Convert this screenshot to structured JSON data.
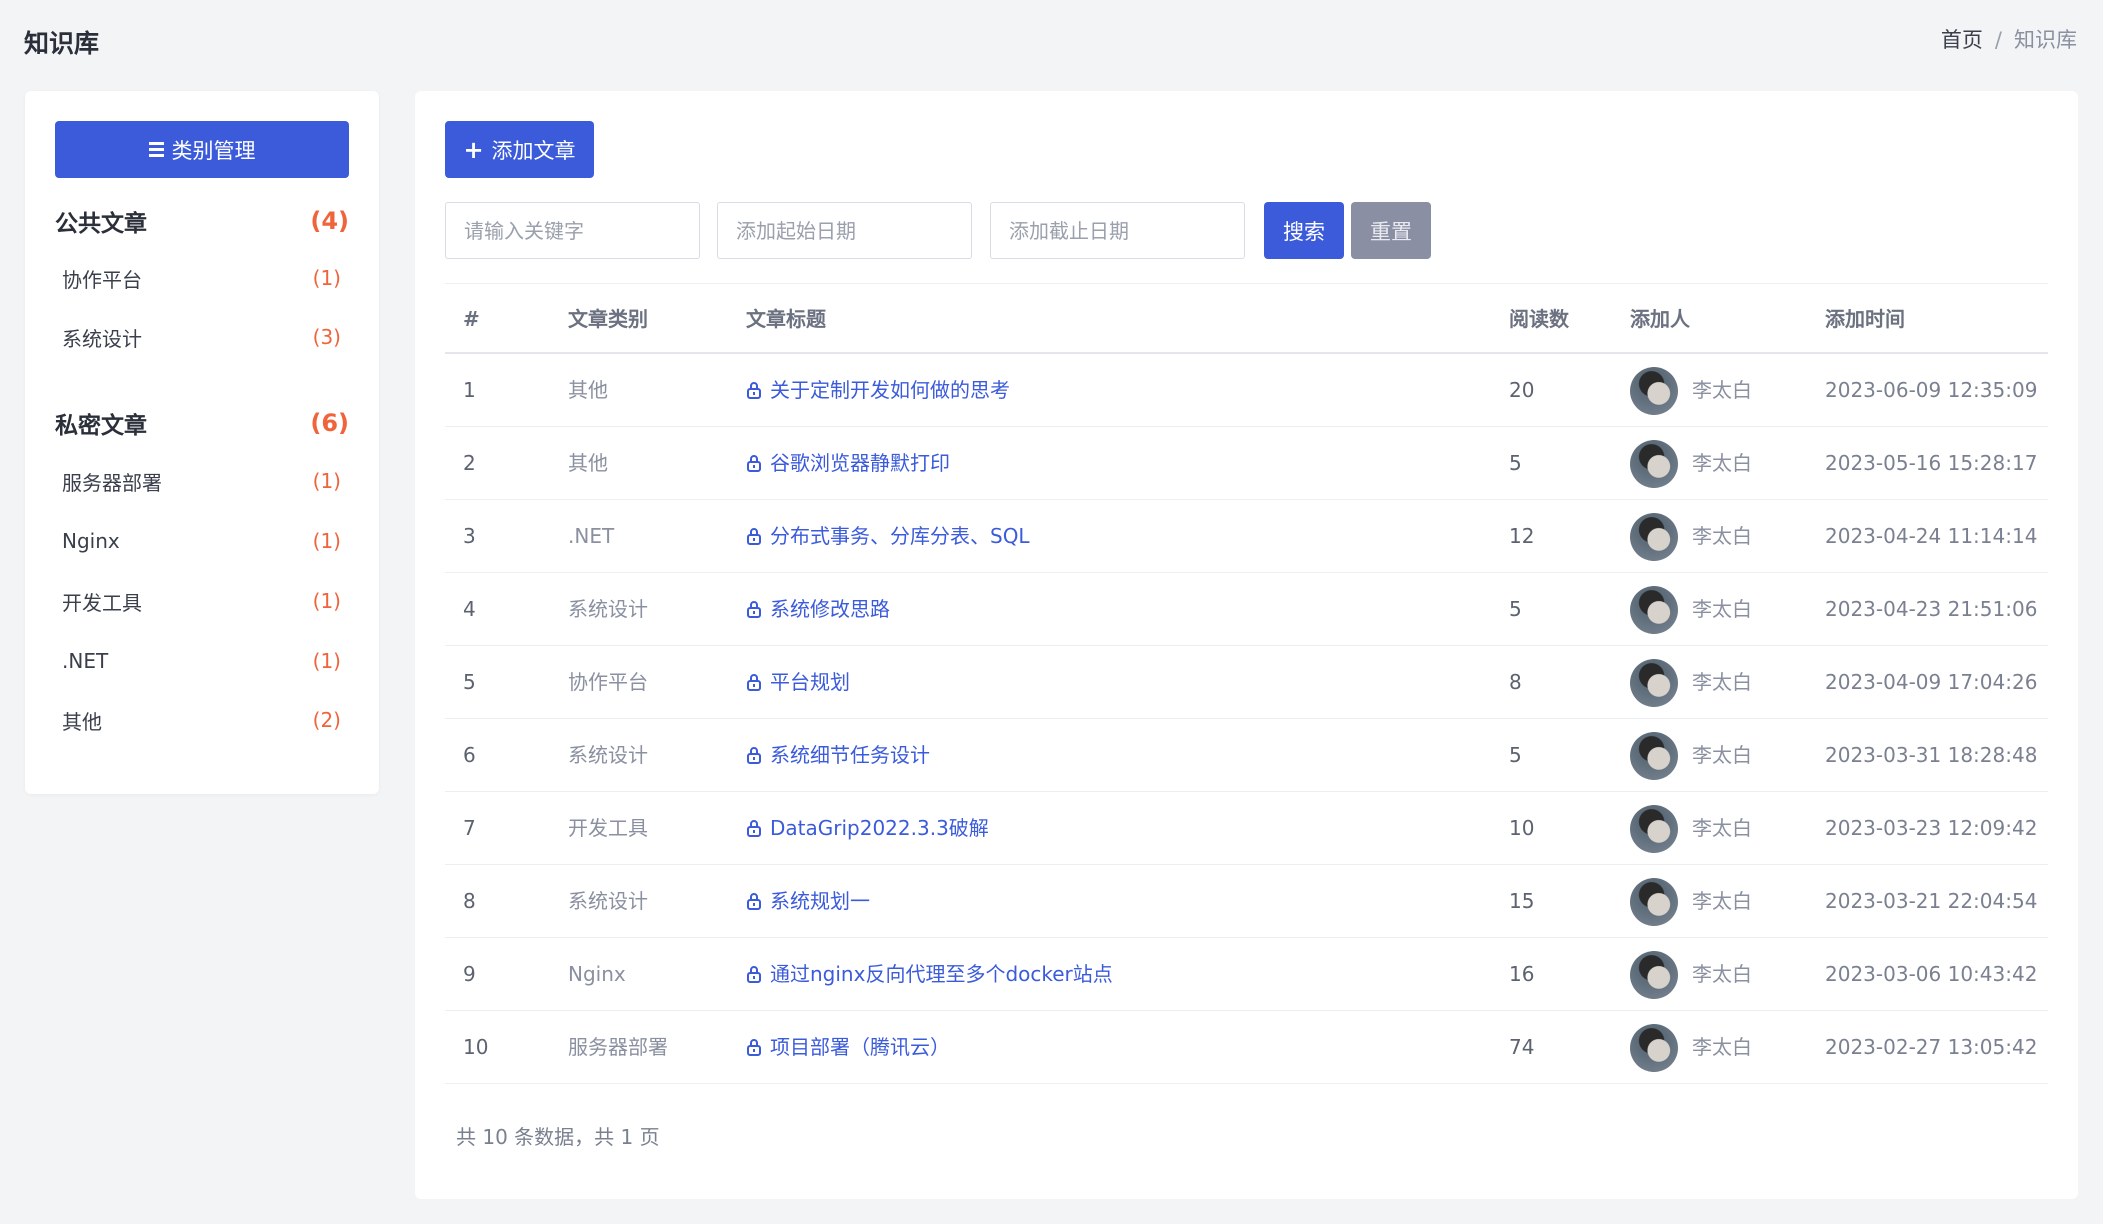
{
  "header": {
    "title": "知识库",
    "breadcrumb": [
      "首页",
      "知识库"
    ]
  },
  "sidebar": {
    "manage_button": "类别管理",
    "public_group": {
      "label": "公共文章",
      "count": "(4)"
    },
    "public_items": [
      {
        "label": "协作平台",
        "count": "(1)"
      },
      {
        "label": "系统设计",
        "count": "(3)"
      }
    ],
    "private_group": {
      "label": "私密文章",
      "count": "(6)"
    },
    "private_items": [
      {
        "label": "服务器部署",
        "count": "(1)"
      },
      {
        "label": "Nginx",
        "count": "(1)"
      },
      {
        "label": "开发工具",
        "count": "(1)"
      },
      {
        "label": ".NET",
        "count": "(1)"
      },
      {
        "label": "其他",
        "count": "(2)"
      }
    ]
  },
  "main": {
    "add_button": "添加文章",
    "search": {
      "keyword_placeholder": "请输入关键字",
      "start_placeholder": "添加起始日期",
      "end_placeholder": "添加截止日期",
      "search_label": "搜索",
      "reset_label": "重置"
    },
    "columns": [
      "#",
      "文章类别",
      "文章标题",
      "阅读数",
      "添加人",
      "添加时间"
    ],
    "rows": [
      {
        "no": "1",
        "category": "其他",
        "title": "关于定制开发如何做的思考",
        "reads": "20",
        "author": "李太白",
        "time": "2023-06-09 12:35:09"
      },
      {
        "no": "2",
        "category": "其他",
        "title": "谷歌浏览器静默打印",
        "reads": "5",
        "author": "李太白",
        "time": "2023-05-16 15:28:17"
      },
      {
        "no": "3",
        "category": ".NET",
        "title": "分布式事务、分库分表、SQL",
        "reads": "12",
        "author": "李太白",
        "time": "2023-04-24 11:14:14"
      },
      {
        "no": "4",
        "category": "系统设计",
        "title": "系统修改思路",
        "reads": "5",
        "author": "李太白",
        "time": "2023-04-23 21:51:06"
      },
      {
        "no": "5",
        "category": "协作平台",
        "title": "平台规划",
        "reads": "8",
        "author": "李太白",
        "time": "2023-04-09 17:04:26"
      },
      {
        "no": "6",
        "category": "系统设计",
        "title": "系统细节任务设计",
        "reads": "5",
        "author": "李太白",
        "time": "2023-03-31 18:28:48"
      },
      {
        "no": "7",
        "category": "开发工具",
        "title": "DataGrip2022.3.3破解",
        "reads": "10",
        "author": "李太白",
        "time": "2023-03-23 12:09:42"
      },
      {
        "no": "8",
        "category": "系统设计",
        "title": "系统规划一",
        "reads": "15",
        "author": "李太白",
        "time": "2023-03-21 22:04:54"
      },
      {
        "no": "9",
        "category": "Nginx",
        "title": "通过nginx反向代理至多个docker站点",
        "reads": "16",
        "author": "李太白",
        "time": "2023-03-06 10:43:42"
      },
      {
        "no": "10",
        "category": "服务器部署",
        "title": "项目部署（腾讯云）",
        "reads": "74",
        "author": "李太白",
        "time": "2023-02-27 13:05:42"
      }
    ],
    "footer": "共 10 条数据，共 1 页"
  },
  "colors": {
    "primary": "#3b5bdb",
    "count_accent": "#f0643c",
    "reset_button": "#8a8fa3",
    "background": "#f3f4f6"
  }
}
